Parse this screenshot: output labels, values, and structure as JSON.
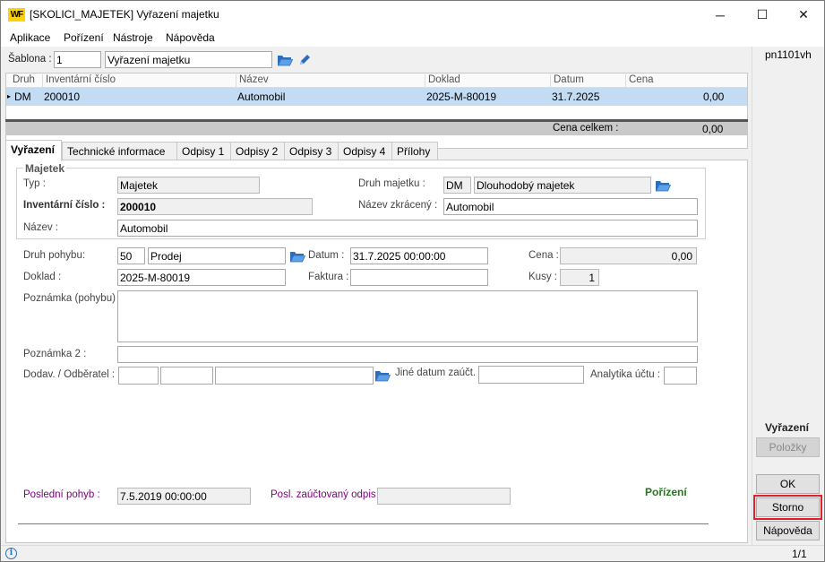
{
  "window": {
    "title": "[SKOLICI_MAJETEK] Vyřazení majetku",
    "logo": "WF",
    "minimize_icon": "─",
    "maximize_icon": "☐",
    "close_icon": "✕"
  },
  "menu": [
    "Aplikace",
    "Pořízení",
    "Nástroje",
    "Nápověda"
  ],
  "sablona": {
    "label": "Šablona :",
    "number": "1",
    "name": "Vyřazení majetku"
  },
  "grid": {
    "headers": [
      "Druh",
      "Inventární číslo",
      "Název",
      "Doklad",
      "Datum",
      "Cena"
    ],
    "rows": [
      {
        "marker": "▸",
        "druh": "DM",
        "inv": "200010",
        "nazev": "Automobil",
        "doklad": "2025-M-80019",
        "datum": "31.7.2025",
        "cena": "0,00"
      }
    ],
    "total_label": "Cena celkem :",
    "total_value": "0,00"
  },
  "tabs": [
    "Vyřazení",
    "Technické informace",
    "Odpisy 1",
    "Odpisy 2",
    "Odpisy 3",
    "Odpisy 4",
    "Přílohy"
  ],
  "majetek": {
    "group_label": "Majetek",
    "typ_label": "Typ :",
    "typ": "Majetek",
    "inv_label": "Inventární číslo :",
    "inv": "200010",
    "nazev_label": "Název :",
    "nazev": "Automobil",
    "druh_label": "Druh majetku :",
    "druh_code": "DM",
    "druh_name": "Dlouhodobý majetek",
    "zkraceny_label": "Název zkrácený :",
    "zkraceny": "Automobil"
  },
  "pohyb": {
    "druh_label": "Druh pohybu:",
    "druh_code": "50",
    "druh_name": "Prodej",
    "datum_label": "Datum :",
    "datum": "31.7.2025 00:00:00",
    "cena_label": "Cena :",
    "cena": "0,00",
    "doklad_label": "Doklad :",
    "doklad": "2025-M-80019",
    "faktura_label": "Faktura :",
    "faktura": "",
    "kusy_label": "Kusy :",
    "kusy": "1",
    "poznamka_label": "Poznámka (pohybu) :",
    "poznamka": "",
    "poznamka2_label": "Poznámka 2 :",
    "poznamka2": "",
    "dodav_label": "Dodav. / Odběratel :",
    "jine_datum_label": "Jiné datum zaúčt.",
    "analytika_label": "Analytika účtu :"
  },
  "footer": {
    "posledni_label": "Poslední pohyb :",
    "posledni": "7.5.2019 00:00:00",
    "posl_odpis_label": "Posl. zaúčtovaný odpis :",
    "posl_odpis": "",
    "status_word": "Pořízení"
  },
  "right_panel": {
    "user": "pn1101vh",
    "section_label": "Vyřazení",
    "polozky": "Položky",
    "ok": "OK",
    "storno": "Storno",
    "napoveda": "Nápověda"
  },
  "statusbar": {
    "info_icon": "i",
    "page": "1/1"
  },
  "colors": {
    "accent_purple": "#800080",
    "status_green": "#1e7b1e",
    "highlight_red": "#e0202a",
    "row_selected": "#c3dcf3"
  }
}
